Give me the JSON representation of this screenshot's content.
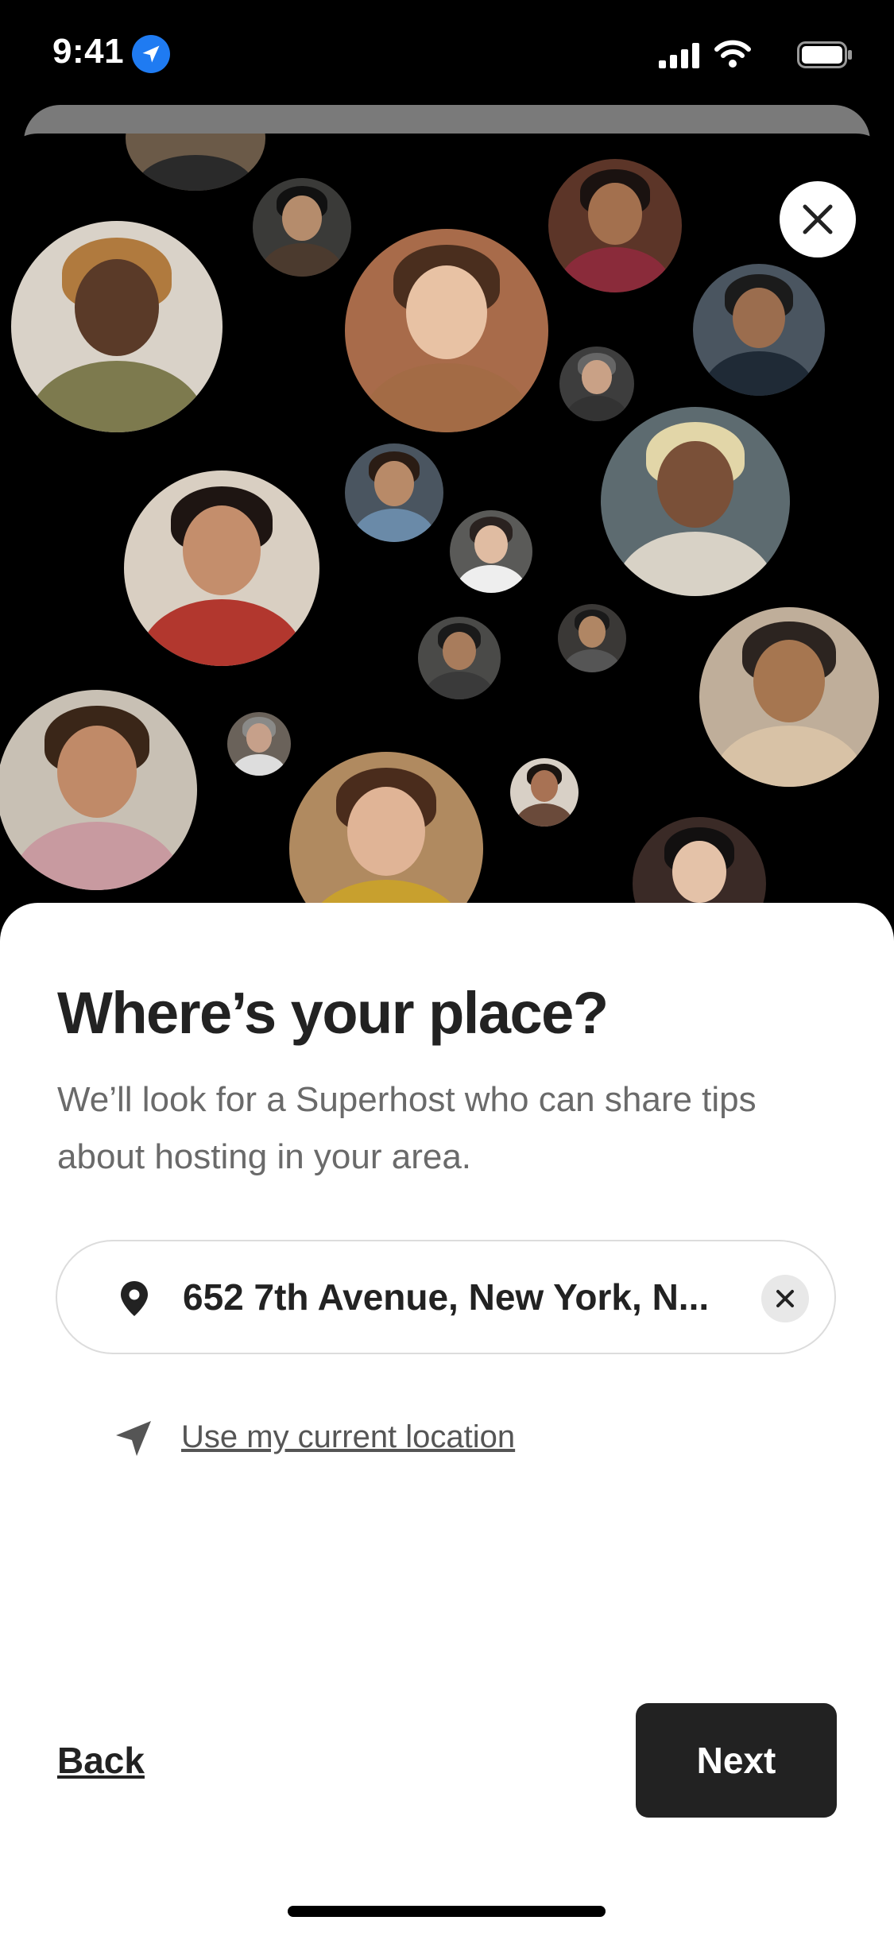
{
  "status_bar": {
    "time": "9:41",
    "icons": [
      "location-arrow-icon",
      "signal-icon",
      "wifi-icon",
      "battery-icon"
    ]
  },
  "header": {
    "close_icon": "close-icon",
    "photo_collage": "superhost-faces"
  },
  "main": {
    "title": "Where’s your place?",
    "subtitle": "We’ll look for a Superhost who can share tips about hosting in your area.",
    "address": {
      "value": "652 7th Avenue, New York, N...",
      "icon": "map-pin-icon",
      "clear_icon": "clear-icon"
    },
    "current_location": {
      "label": "Use my current location",
      "icon": "navigation-arrow-icon"
    }
  },
  "footer": {
    "back_label": "Back",
    "next_label": "Next"
  },
  "colors": {
    "primary_text": "#222222",
    "secondary_text": "#6a6a6a",
    "button_bg": "#222222",
    "status_accent": "#1f7bf2",
    "background": "#000000",
    "sheet": "#ffffff"
  }
}
